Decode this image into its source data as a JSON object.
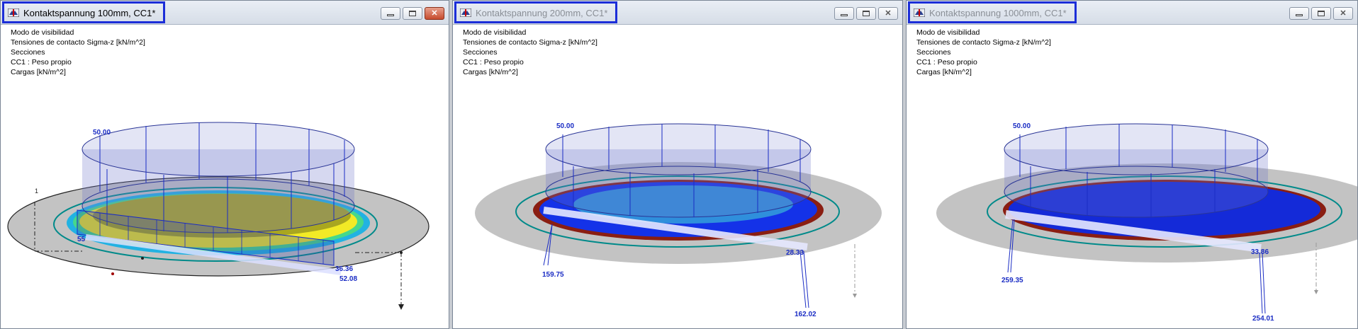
{
  "colors": {
    "highlight": "#1c2ed8",
    "load": "#1a2cc4",
    "plate": "#c3c3c3",
    "mesh": "#1432e8",
    "contour": "#008a8a"
  },
  "panels": [
    {
      "title": "Kontaktspannung 100mm, CC1*",
      "active": true,
      "info": [
        "Modo de visibilidad",
        "Tensiones de contacto Sigma-z [kN/m^2]",
        "Secciones",
        "CC1 : Peso propio",
        "Cargas [kN/m^2]"
      ],
      "load_label": "50.00",
      "node_label": "1",
      "values": [
        "55",
        "36.36",
        "52.08"
      ]
    },
    {
      "title": "Kontaktspannung 200mm, CC1*",
      "active": false,
      "info": [
        "Modo de visibilidad",
        "Tensiones de contacto Sigma-z [kN/m^2]",
        "Secciones",
        "CC1 : Peso propio",
        "Cargas [kN/m^2]"
      ],
      "load_label": "50.00",
      "values": [
        "28.33",
        "159.75",
        "162.02"
      ]
    },
    {
      "title": "Kontaktspannung 1000mm, CC1*",
      "active": false,
      "info": [
        "Modo de visibilidad",
        "Tensiones de contacto Sigma-z [kN/m^2]",
        "Secciones",
        "CC1 : Peso propio",
        "Cargas [kN/m^2]"
      ],
      "load_label": "50.00",
      "values": [
        "33.86",
        "259.35",
        "254.01"
      ]
    }
  ],
  "icons": {
    "app": "rfem-app-icon",
    "minimize": "minimize-icon",
    "maximize": "maximize-icon",
    "close": "close-icon"
  }
}
